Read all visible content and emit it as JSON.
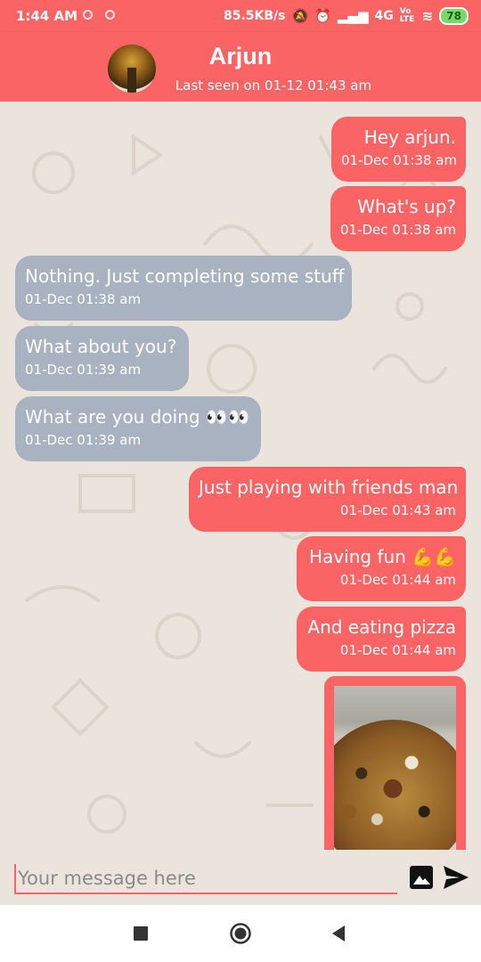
{
  "status_bar": {
    "time": "1:44 AM",
    "speed": "85.5KB/s",
    "network": "4G",
    "volte": "Vo LTE",
    "battery": "78"
  },
  "header": {
    "name": "Arjun",
    "last_seen": "Last seen on 01-12 01:43 am"
  },
  "messages": [
    {
      "direction": "sent",
      "text": "Hey arjun.",
      "time": "01-Dec 01:38 am"
    },
    {
      "direction": "sent",
      "text": "What's up?",
      "time": "01-Dec 01:38 am"
    },
    {
      "direction": "received",
      "text": "Nothing. Just completing some stuff",
      "time": "01-Dec 01:38 am"
    },
    {
      "direction": "received",
      "text": "What about you?",
      "time": "01-Dec 01:39 am"
    },
    {
      "direction": "received",
      "text": "What are you doing 👀👀",
      "time": "01-Dec 01:39 am"
    },
    {
      "direction": "sent",
      "text": "Just playing with friends man",
      "time": "01-Dec 01:43 am"
    },
    {
      "direction": "sent",
      "text": "Having fun 💪💪",
      "time": "01-Dec 01:44 am"
    },
    {
      "direction": "sent",
      "text": "And eating pizza",
      "time": "01-Dec 01:44 am"
    }
  ],
  "composer": {
    "placeholder": "Your message here"
  },
  "colors": {
    "accent": "#fb6465",
    "received_bubble": "#a9b2c0",
    "chat_background": "#ebe4dc"
  },
  "icons": {
    "image_button": "image-icon",
    "send_button": "send-icon",
    "nav": [
      "recents-square-icon",
      "home-circle-icon",
      "back-triangle-icon"
    ]
  }
}
